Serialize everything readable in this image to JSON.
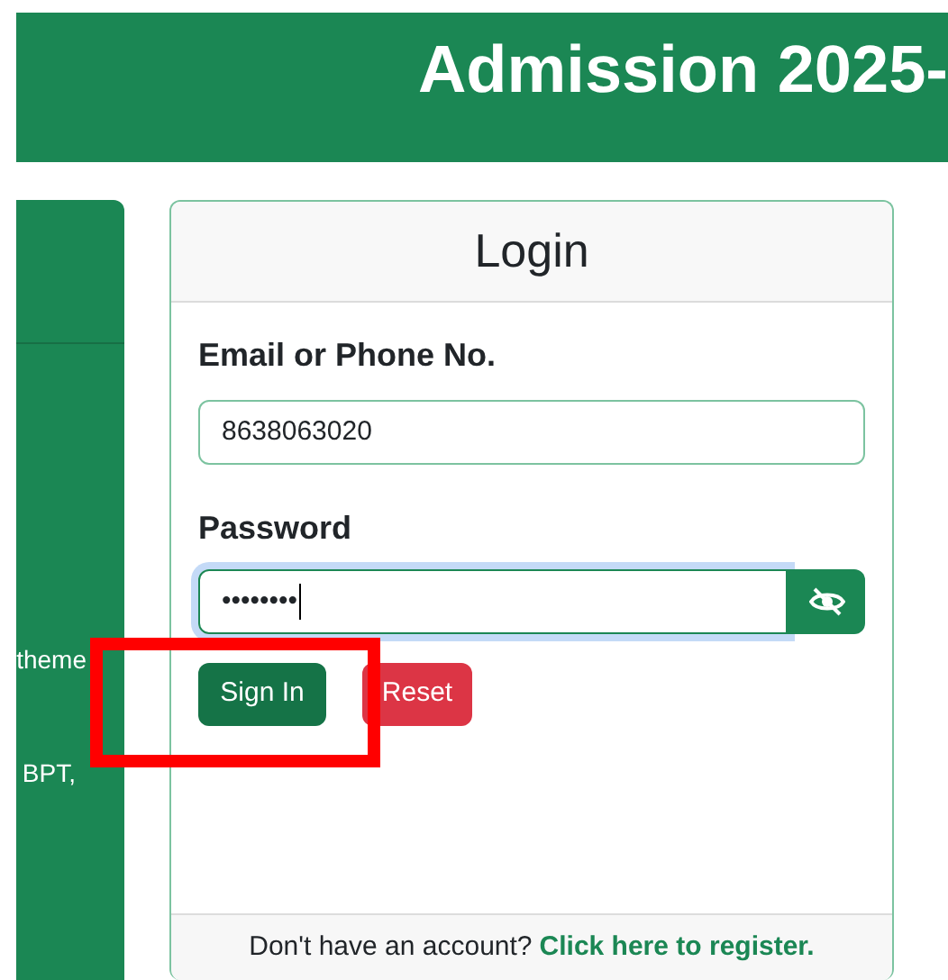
{
  "header": {
    "title": "Admission 2025-"
  },
  "sidebar": {
    "texts": [
      "theme",
      "BPT,"
    ]
  },
  "login": {
    "title": "Login",
    "fields": [
      {
        "kind": "text",
        "label": "Email or Phone No.",
        "value": "8638063020",
        "focused": false
      },
      {
        "kind": "password",
        "label": "Password",
        "value": "••••••••",
        "focused": true
      }
    ],
    "buttons": [
      {
        "label": "Sign In",
        "kind": "primary"
      },
      {
        "label": "Reset",
        "kind": "danger"
      }
    ],
    "footer": {
      "text": "Don't have an account?",
      "link": "Click here to register."
    }
  },
  "annotation": {
    "kind": "rectangle"
  }
}
